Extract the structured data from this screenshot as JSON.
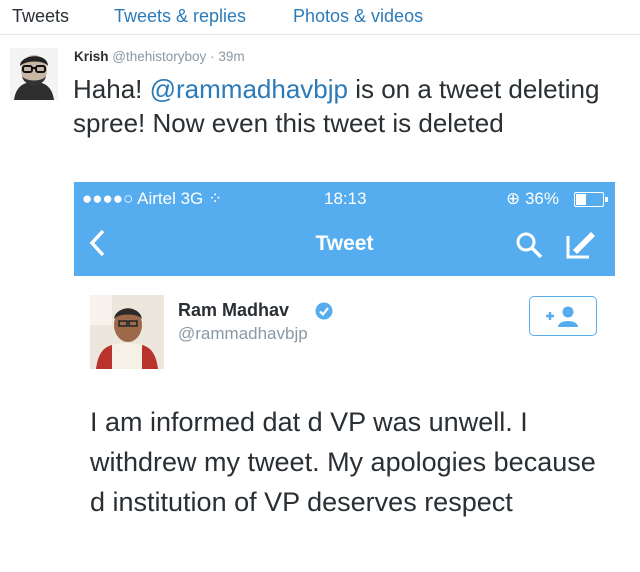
{
  "tabs": [
    {
      "label": "Tweets"
    },
    {
      "label": "Tweets & replies"
    },
    {
      "label": "Photos & videos"
    }
  ],
  "tweet": {
    "author_name": "Krish",
    "author_handle": "@thehistoryboy",
    "separator": "·",
    "time": "39m",
    "text_before": "Haha! ",
    "mention": "@rammadhavbjp",
    "text_after": " is on a tweet deleting spree! Now even this tweet is deleted"
  },
  "screenshot": {
    "status_bar": {
      "carrier": "●●●●○ Airtel  3G  ⁘",
      "time": "18:13",
      "battery": "⊕ 36%"
    },
    "nav": {
      "title": "Tweet"
    },
    "embedded_tweet": {
      "name": "Ram Madhav",
      "handle": "@rammadhavbjp",
      "text": "I am informed dat d VP was unwell. I withdrew my tweet. My apologies because d institution of VP deserves respect"
    },
    "colors": {
      "header_blue": "#55acee",
      "link_blue": "#2b7bb9"
    },
    "icons": [
      "back-chevron-icon",
      "search-icon",
      "compose-icon",
      "verified-badge-icon",
      "follow-user-icon"
    ]
  }
}
